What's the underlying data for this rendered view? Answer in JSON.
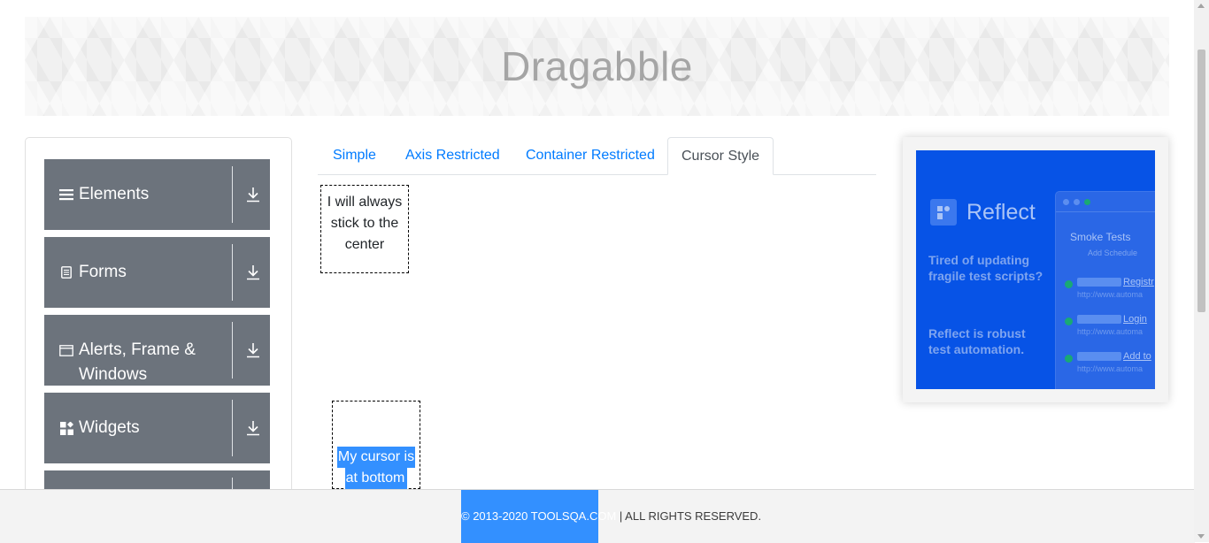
{
  "page": {
    "title": "Dragabble"
  },
  "sidebar": {
    "groups": [
      {
        "label": "Elements",
        "icon": "hamburger-icon"
      },
      {
        "label": "Forms",
        "icon": "document-icon"
      },
      {
        "label": "Alerts, Frame & Windows",
        "icon": "window-icon"
      },
      {
        "label": "Widgets",
        "icon": "widgets-icon"
      },
      {
        "label": "",
        "icon": ""
      }
    ],
    "expand_icon": "download-arrow-icon",
    "group_color": "#6c737c"
  },
  "tabs": [
    {
      "label": "Simple",
      "active": false
    },
    {
      "label": "Axis Restricted",
      "active": false
    },
    {
      "label": "Container Restricted",
      "active": false
    },
    {
      "label": "Cursor Style",
      "active": true
    }
  ],
  "draggables": {
    "center": "I will always stick to the center",
    "bottom_line1": "My cursor is",
    "bottom_line2": "at bottom"
  },
  "ad": {
    "brand": "Reflect",
    "text1": "Tired of updating fragile test scripts?",
    "text2": "Reflect is robust test automation.",
    "window_title": "Smoke Tests",
    "window_sub": "Add Schedule",
    "rows": [
      {
        "link": "Registr",
        "url": "http://www.automa"
      },
      {
        "link": "Login",
        "url": "http://www.automa"
      },
      {
        "link": "Add to",
        "url": "http://www.automa"
      }
    ],
    "bg_color": "#0753e6"
  },
  "footer": {
    "selected": "© 2013-2020 TOOLSQA.COM",
    "rest": " | ALL RIGHTS RESERVED."
  },
  "colors": {
    "link": "#007bff",
    "selection": "#3390ff"
  }
}
